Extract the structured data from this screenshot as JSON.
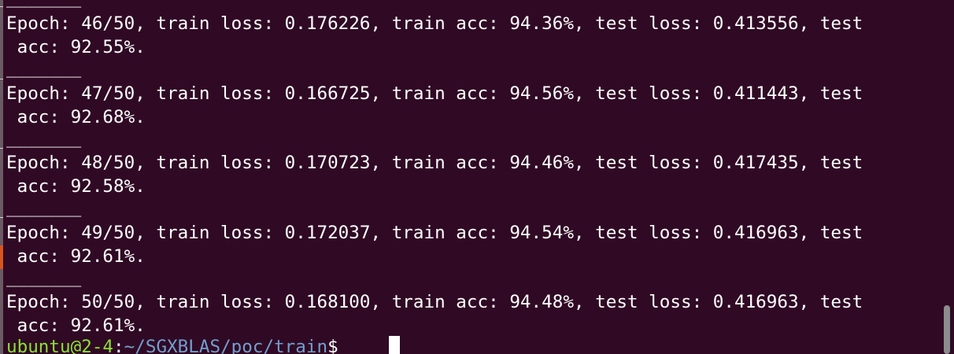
{
  "terminal": {
    "separator": "_______",
    "entries": [
      {
        "line1": "Epoch: 46/50, train loss: 0.176226, train acc: 94.36%, test loss: 0.413556, test",
        "line2": " acc: 92.55%."
      },
      {
        "line1": "Epoch: 47/50, train loss: 0.166725, train acc: 94.56%, test loss: 0.411443, test",
        "line2": " acc: 92.68%."
      },
      {
        "line1": "Epoch: 48/50, train loss: 0.170723, train acc: 94.46%, test loss: 0.417435, test",
        "line2": " acc: 92.58%."
      },
      {
        "line1": "Epoch: 49/50, train loss: 0.172037, train acc: 94.54%, test loss: 0.416963, test",
        "line2": " acc: 92.61%."
      },
      {
        "line1": "Epoch: 50/50, train loss: 0.168100, train acc: 94.48%, test loss: 0.416963, test",
        "line2": " acc: 92.61%."
      }
    ],
    "prompt": {
      "user_host": "ubuntu@2-4",
      "separator": ":",
      "path": "~/SGXBLAS/poc/train",
      "symbol": "$ "
    }
  },
  "colors": {
    "background": "#300a24",
    "text": "#ffffff",
    "prompt_user": "#8ae234",
    "prompt_path": "#729fcf"
  }
}
